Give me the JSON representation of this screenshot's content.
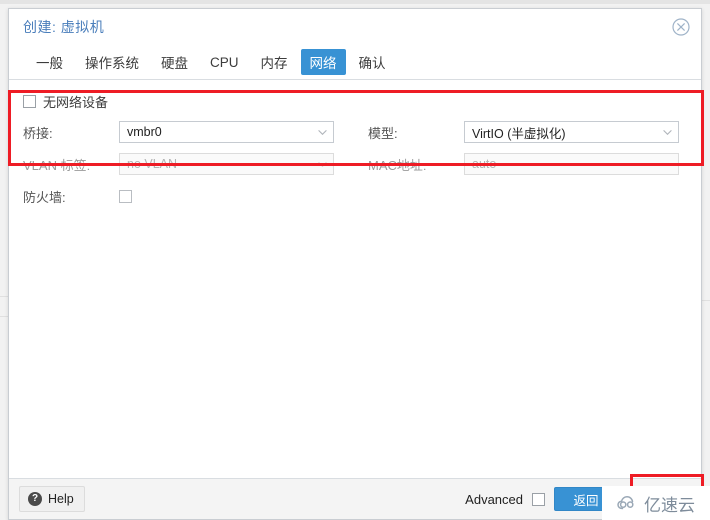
{
  "window": {
    "title": "创建: 虚拟机",
    "close_icon": "close-circle-icon"
  },
  "tabs": [
    {
      "label": "一般",
      "active": false
    },
    {
      "label": "操作系统",
      "active": false
    },
    {
      "label": "硬盘",
      "active": false
    },
    {
      "label": "CPU",
      "active": false
    },
    {
      "label": "内存",
      "active": false
    },
    {
      "label": "网络",
      "active": true
    },
    {
      "label": "确认",
      "active": false
    }
  ],
  "form": {
    "no_network_device": {
      "label": "无网络设备",
      "checked": false
    },
    "bridge": {
      "label": "桥接:",
      "value": "vmbr0",
      "icon": "chevron-down-icon"
    },
    "model": {
      "label": "模型:",
      "value": "VirtIO (半虚拟化)",
      "icon": "chevron-down-icon"
    },
    "vlan_tag": {
      "label": "VLAN 标签:",
      "placeholder": "no VLAN",
      "icon": "chevron-down-icon",
      "disabled": true
    },
    "mac_address": {
      "label": "MAC地址:",
      "placeholder": "auto",
      "disabled": true
    },
    "firewall": {
      "label": "防火墙:",
      "checked": false
    }
  },
  "footer": {
    "help_label": "Help",
    "help_icon": "question-mark-icon",
    "advanced_label": "Advanced",
    "advanced_checked": false,
    "back_label": "返回",
    "next_label": ""
  },
  "annotations": {
    "network_box_color": "#ee1c25",
    "next_box_color": "#ee1c25"
  },
  "watermark": {
    "text": "亿速云",
    "icon": "cloud-logo-icon",
    "color": "#7e8c9b"
  },
  "colors": {
    "accent": "#3892d4",
    "title": "#4a7ebb",
    "annotation": "#ee1c25"
  }
}
